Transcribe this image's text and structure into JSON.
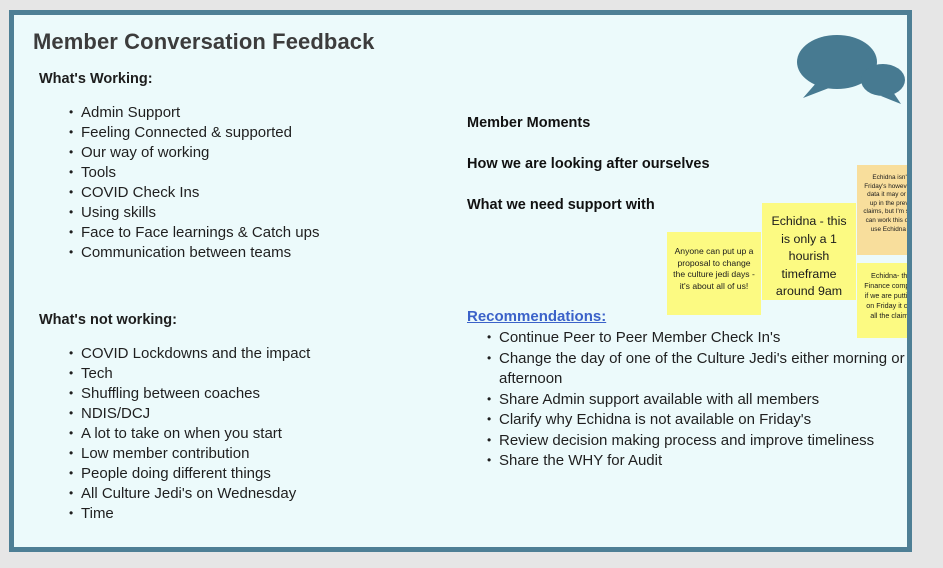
{
  "slide": {
    "title": "Member Conversation Feedback",
    "border_color": "#4e7f95",
    "background_color": "#ecfafb",
    "page_background": "#e6e6e6",
    "icon": "speech-bubbles-icon",
    "icon_color": "#477a91"
  },
  "left_column": {
    "working": {
      "heading": "What's Working:",
      "items": [
        "Admin Support",
        "Feeling Connected & supported",
        "Our way of working",
        "Tools",
        "COVID Check Ins",
        "Using skills",
        "Face to Face learnings & Catch ups",
        "Communication between teams"
      ]
    },
    "not_working": {
      "heading": "What's not working:",
      "items": [
        "COVID Lockdowns and the impact",
        "Tech",
        "Shuffling between coaches",
        "NDIS/DCJ",
        "A lot to take on when you start",
        "Low member contribution",
        "People doing different things",
        "All Culture Jedi's on Wednesday",
        "Time"
      ]
    }
  },
  "right_column": {
    "headings": [
      "Member Moments",
      "How we are looking after ourselves",
      "What we need support with"
    ],
    "recommendations": {
      "title": "Recommendations:",
      "title_color": "#3b62c9",
      "items": [
        "Continue Peer to Peer Member Check In's",
        "Change the day of one of the Culture Jedi's either morning or afternoon",
        "Share Admin support available with all members",
        "Clarify why Echidna is not available on Friday's",
        "Review decision making process and improve timeliness",
        "Share the WHY for Audit"
      ]
    }
  },
  "sticky_notes": [
    {
      "id": "proposal",
      "text": "Anyone can put up a proposal to change the culture jedi days - it's about all of us!",
      "color": "#fcfa82"
    },
    {
      "id": "echidna-time",
      "text": "Echidna - this is only a 1 hourish timeframe around 9am",
      "color": "#fcfa82"
    },
    {
      "id": "echidna-friday",
      "text": "Echidna isn't closed on Friday's however if you enter data it may or may not end up in the previous weeks claims, but I'm sure members can work this out, so please use Echidna on Firdays!",
      "color": "#f8de9c"
    },
    {
      "id": "echidna-finance",
      "text": "Echidna- this is when Finance complete claims- if we are putting in claims on Friday it can interrupt all the claims. (Jason)",
      "color": "#fcfa82"
    }
  ]
}
